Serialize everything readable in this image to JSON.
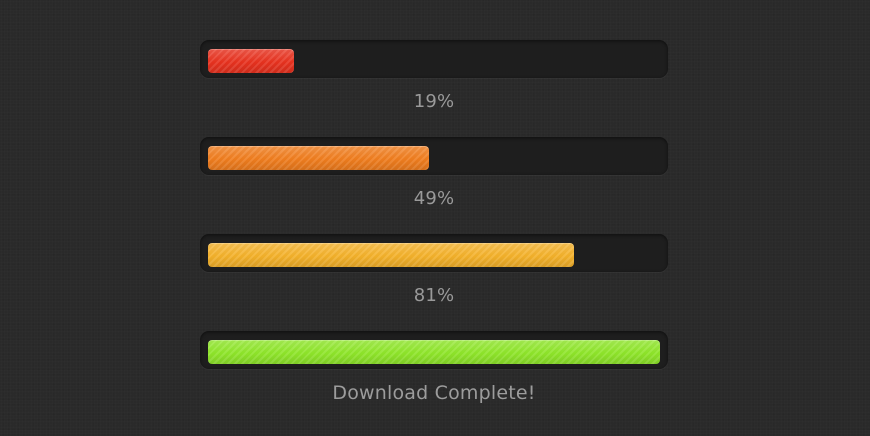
{
  "bars": [
    {
      "label": "19%",
      "progress": 0.19,
      "color": "#e8321f"
    },
    {
      "label": "49%",
      "progress": 0.49,
      "color": "#f07d1e"
    },
    {
      "label": "81%",
      "progress": 0.81,
      "color": "#f4b12a"
    },
    {
      "label": "Download Complete!",
      "progress": 1.0,
      "color": "#8fe62a"
    }
  ]
}
